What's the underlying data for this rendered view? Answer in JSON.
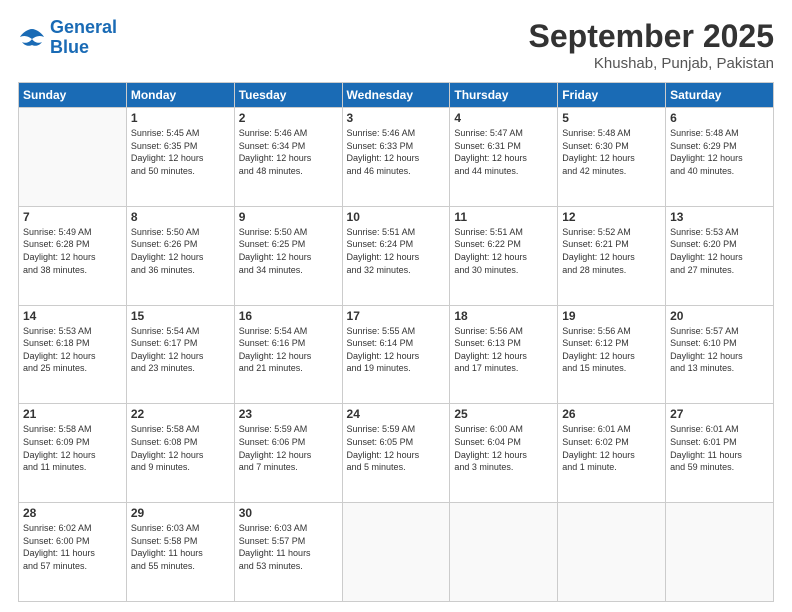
{
  "header": {
    "logo_general": "General",
    "logo_blue": "Blue",
    "month": "September 2025",
    "location": "Khushab, Punjab, Pakistan"
  },
  "weekdays": [
    "Sunday",
    "Monday",
    "Tuesday",
    "Wednesday",
    "Thursday",
    "Friday",
    "Saturday"
  ],
  "weeks": [
    [
      {
        "day": "",
        "info": ""
      },
      {
        "day": "1",
        "info": "Sunrise: 5:45 AM\nSunset: 6:35 PM\nDaylight: 12 hours\nand 50 minutes."
      },
      {
        "day": "2",
        "info": "Sunrise: 5:46 AM\nSunset: 6:34 PM\nDaylight: 12 hours\nand 48 minutes."
      },
      {
        "day": "3",
        "info": "Sunrise: 5:46 AM\nSunset: 6:33 PM\nDaylight: 12 hours\nand 46 minutes."
      },
      {
        "day": "4",
        "info": "Sunrise: 5:47 AM\nSunset: 6:31 PM\nDaylight: 12 hours\nand 44 minutes."
      },
      {
        "day": "5",
        "info": "Sunrise: 5:48 AM\nSunset: 6:30 PM\nDaylight: 12 hours\nand 42 minutes."
      },
      {
        "day": "6",
        "info": "Sunrise: 5:48 AM\nSunset: 6:29 PM\nDaylight: 12 hours\nand 40 minutes."
      }
    ],
    [
      {
        "day": "7",
        "info": "Sunrise: 5:49 AM\nSunset: 6:28 PM\nDaylight: 12 hours\nand 38 minutes."
      },
      {
        "day": "8",
        "info": "Sunrise: 5:50 AM\nSunset: 6:26 PM\nDaylight: 12 hours\nand 36 minutes."
      },
      {
        "day": "9",
        "info": "Sunrise: 5:50 AM\nSunset: 6:25 PM\nDaylight: 12 hours\nand 34 minutes."
      },
      {
        "day": "10",
        "info": "Sunrise: 5:51 AM\nSunset: 6:24 PM\nDaylight: 12 hours\nand 32 minutes."
      },
      {
        "day": "11",
        "info": "Sunrise: 5:51 AM\nSunset: 6:22 PM\nDaylight: 12 hours\nand 30 minutes."
      },
      {
        "day": "12",
        "info": "Sunrise: 5:52 AM\nSunset: 6:21 PM\nDaylight: 12 hours\nand 28 minutes."
      },
      {
        "day": "13",
        "info": "Sunrise: 5:53 AM\nSunset: 6:20 PM\nDaylight: 12 hours\nand 27 minutes."
      }
    ],
    [
      {
        "day": "14",
        "info": "Sunrise: 5:53 AM\nSunset: 6:18 PM\nDaylight: 12 hours\nand 25 minutes."
      },
      {
        "day": "15",
        "info": "Sunrise: 5:54 AM\nSunset: 6:17 PM\nDaylight: 12 hours\nand 23 minutes."
      },
      {
        "day": "16",
        "info": "Sunrise: 5:54 AM\nSunset: 6:16 PM\nDaylight: 12 hours\nand 21 minutes."
      },
      {
        "day": "17",
        "info": "Sunrise: 5:55 AM\nSunset: 6:14 PM\nDaylight: 12 hours\nand 19 minutes."
      },
      {
        "day": "18",
        "info": "Sunrise: 5:56 AM\nSunset: 6:13 PM\nDaylight: 12 hours\nand 17 minutes."
      },
      {
        "day": "19",
        "info": "Sunrise: 5:56 AM\nSunset: 6:12 PM\nDaylight: 12 hours\nand 15 minutes."
      },
      {
        "day": "20",
        "info": "Sunrise: 5:57 AM\nSunset: 6:10 PM\nDaylight: 12 hours\nand 13 minutes."
      }
    ],
    [
      {
        "day": "21",
        "info": "Sunrise: 5:58 AM\nSunset: 6:09 PM\nDaylight: 12 hours\nand 11 minutes."
      },
      {
        "day": "22",
        "info": "Sunrise: 5:58 AM\nSunset: 6:08 PM\nDaylight: 12 hours\nand 9 minutes."
      },
      {
        "day": "23",
        "info": "Sunrise: 5:59 AM\nSunset: 6:06 PM\nDaylight: 12 hours\nand 7 minutes."
      },
      {
        "day": "24",
        "info": "Sunrise: 5:59 AM\nSunset: 6:05 PM\nDaylight: 12 hours\nand 5 minutes."
      },
      {
        "day": "25",
        "info": "Sunrise: 6:00 AM\nSunset: 6:04 PM\nDaylight: 12 hours\nand 3 minutes."
      },
      {
        "day": "26",
        "info": "Sunrise: 6:01 AM\nSunset: 6:02 PM\nDaylight: 12 hours\nand 1 minute."
      },
      {
        "day": "27",
        "info": "Sunrise: 6:01 AM\nSunset: 6:01 PM\nDaylight: 11 hours\nand 59 minutes."
      }
    ],
    [
      {
        "day": "28",
        "info": "Sunrise: 6:02 AM\nSunset: 6:00 PM\nDaylight: 11 hours\nand 57 minutes."
      },
      {
        "day": "29",
        "info": "Sunrise: 6:03 AM\nSunset: 5:58 PM\nDaylight: 11 hours\nand 55 minutes."
      },
      {
        "day": "30",
        "info": "Sunrise: 6:03 AM\nSunset: 5:57 PM\nDaylight: 11 hours\nand 53 minutes."
      },
      {
        "day": "",
        "info": ""
      },
      {
        "day": "",
        "info": ""
      },
      {
        "day": "",
        "info": ""
      },
      {
        "day": "",
        "info": ""
      }
    ]
  ]
}
